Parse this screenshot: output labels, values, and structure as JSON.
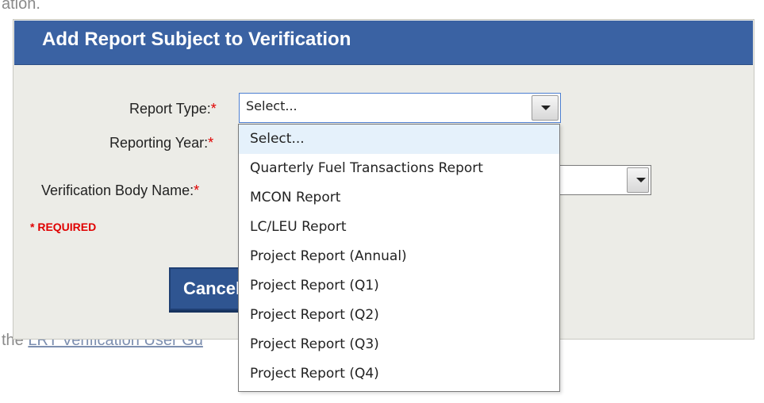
{
  "background_page": {
    "top_fragment": "ation.",
    "link_prefix": "the",
    "link_text": "LRT Verification User Gu"
  },
  "modal": {
    "title": "Add Report Subject to Verification",
    "report_type_label": "Report Type:",
    "reporting_year_label": "Reporting Year:",
    "verification_body_label": "Verification Body Name:",
    "required_star": "*",
    "required_note": "* REQUIRED",
    "report_type_value": "Select...",
    "cancel_label": "Cancel"
  },
  "dropdown": {
    "options": [
      "Select...",
      "Quarterly Fuel Transactions Report",
      "MCON Report",
      "LC/LEU Report",
      "Project Report (Annual)",
      "Project Report (Q1)",
      "Project Report (Q2)",
      "Project Report (Q3)",
      "Project Report (Q4)"
    ],
    "highlighted_index": 0
  },
  "colors": {
    "header_blue": "#3a62a3",
    "button_blue": "#2f5591",
    "required_red": "#e00000",
    "highlight": "#e5f1fb"
  }
}
